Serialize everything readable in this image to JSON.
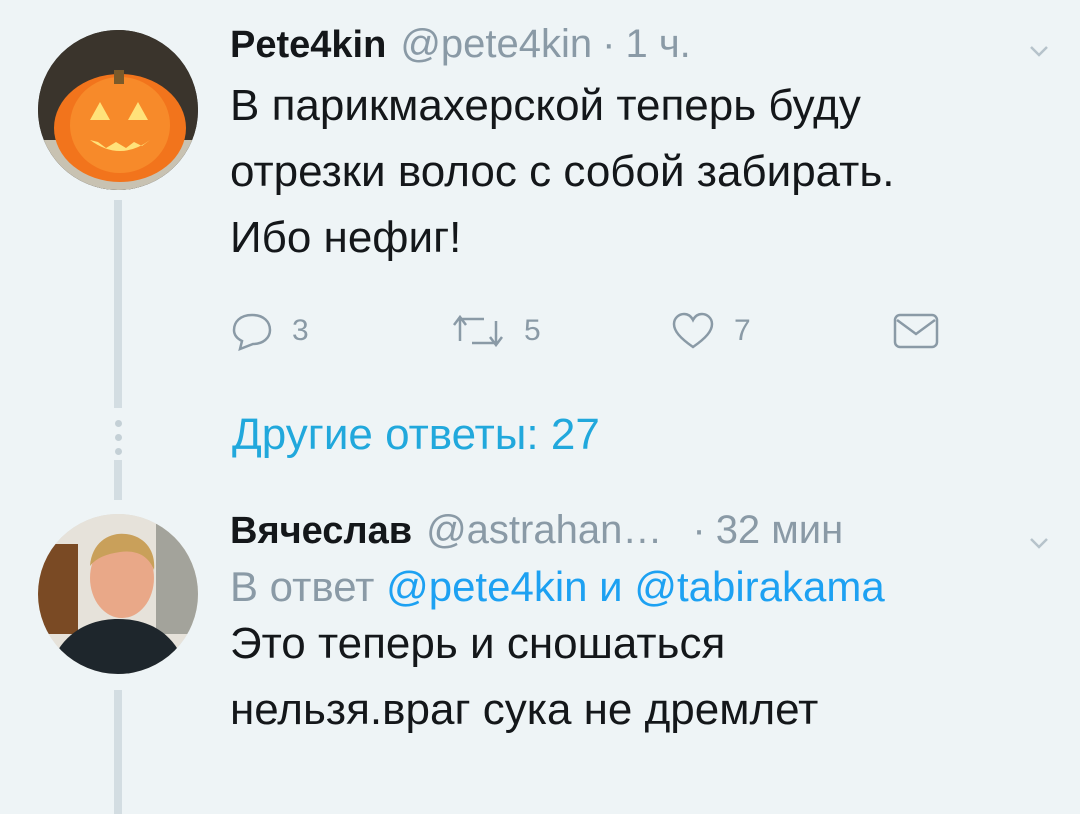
{
  "tweet1": {
    "name": "Pete4kin",
    "handle": "@pete4kin",
    "separator": "·",
    "time": "1 ч.",
    "text_line1": "В парикмахерской теперь буду",
    "text_line2": "отрезки волос с собой забирать.",
    "text_line3": "Ибо нефиг!",
    "reply_count": "3",
    "retweet_count": "5",
    "like_count": "7"
  },
  "more_replies": "Другие ответы: 27",
  "tweet2": {
    "name": "Вячеслав",
    "handle": "@astrahan…",
    "separator": "·",
    "time": "32 мин",
    "reply_prefix": "В ответ ",
    "mention1": "@pete4kin",
    "conj": " и ",
    "mention2": "@tabirakama",
    "text_line1": "Это теперь и сношаться",
    "text_line2": "нельзя.враг сука не дремлет"
  },
  "icons": {
    "reply": "reply-icon",
    "retweet": "retweet-icon",
    "like": "heart-icon",
    "dm": "envelope-icon",
    "menu": "chevron-down-icon"
  },
  "colors": {
    "background": "#eef4f6",
    "link": "#1da1f2",
    "muted": "#8a9aa6"
  }
}
